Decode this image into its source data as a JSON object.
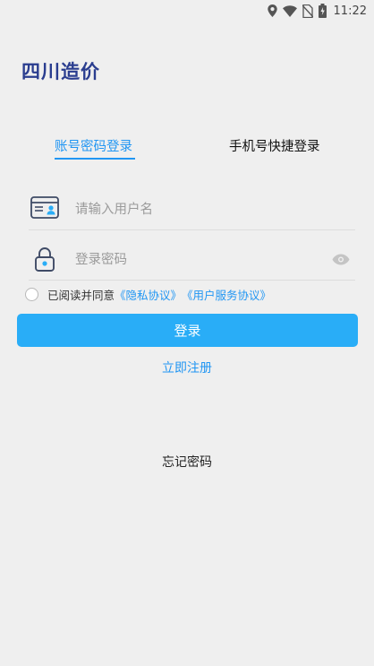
{
  "status_bar": {
    "time": "11:22"
  },
  "app": {
    "title": "四川造价"
  },
  "tabs": [
    {
      "label": "账号密码登录"
    },
    {
      "label": "手机号快捷登录"
    }
  ],
  "form": {
    "username_placeholder": "请输入用户名",
    "password_placeholder": "登录密码"
  },
  "agreement": {
    "prefix": "已阅读并同意",
    "privacy": "《隐私协议》",
    "service": "《用户服务协议》"
  },
  "buttons": {
    "login": "登录",
    "register": "立即注册",
    "forgot": "忘记密码"
  },
  "colors": {
    "accent": "#2196f3",
    "button": "#29adf7",
    "title": "#2a3d8f",
    "background": "#efefef"
  },
  "icons": [
    "location-icon",
    "wifi-icon",
    "no-sim-icon",
    "battery-icon",
    "id-card-icon",
    "lock-icon",
    "eye-icon"
  ]
}
